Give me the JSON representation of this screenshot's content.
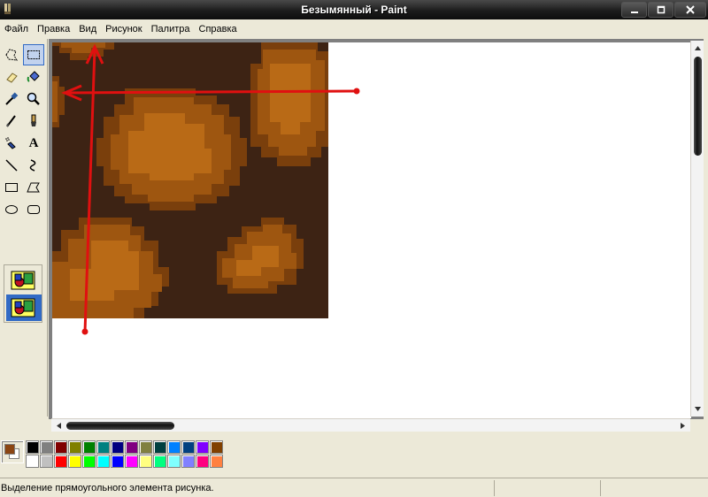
{
  "window": {
    "title": "Безымянный - Paint",
    "app_icon": "paint-brush-icon"
  },
  "menu": [
    "Файл",
    "Правка",
    "Вид",
    "Рисунок",
    "Палитра",
    "Справка"
  ],
  "tools": [
    {
      "name": "free-form-select-icon"
    },
    {
      "name": "rectangle-select-icon",
      "selected": true
    },
    {
      "name": "eraser-icon"
    },
    {
      "name": "fill-bucket-icon"
    },
    {
      "name": "color-picker-icon"
    },
    {
      "name": "magnifier-icon"
    },
    {
      "name": "pencil-icon"
    },
    {
      "name": "brush-icon"
    },
    {
      "name": "airbrush-icon"
    },
    {
      "name": "text-icon",
      "glyph": "A"
    },
    {
      "name": "line-icon"
    },
    {
      "name": "curve-icon"
    },
    {
      "name": "rectangle-icon"
    },
    {
      "name": "polygon-icon"
    },
    {
      "name": "ellipse-icon"
    },
    {
      "name": "rounded-rectangle-icon"
    }
  ],
  "palette": {
    "foreground": "#8b4513",
    "background": "#ffffff",
    "row1": [
      "#000000",
      "#808080",
      "#800000",
      "#808000",
      "#008000",
      "#008080",
      "#000080",
      "#800080",
      "#808040",
      "#004040",
      "#0080ff",
      "#004080",
      "#8000ff",
      "#804000"
    ],
    "row2": [
      "#ffffff",
      "#c0c0c0",
      "#ff0000",
      "#ffff00",
      "#00ff00",
      "#00ffff",
      "#0000ff",
      "#ff00ff",
      "#ffff80",
      "#00ff80",
      "#80ffff",
      "#8080ff",
      "#ff0080",
      "#ff8040"
    ]
  },
  "image_colors": {
    "dark": "#3d2314",
    "mid": "#7a3f0c",
    "light": "#9e5610",
    "bright": "#b96a16"
  },
  "annotation_color": "#e01010",
  "status": {
    "text": "Выделение прямоугольного элемента рисунка."
  }
}
